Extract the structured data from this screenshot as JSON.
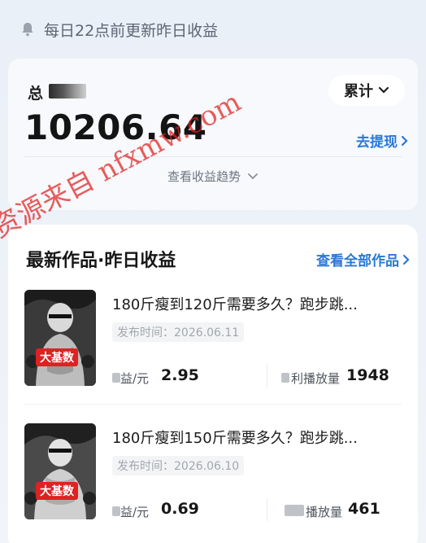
{
  "notice": {
    "text": "每日22点前更新昨日收益",
    "icon": "bell-icon"
  },
  "summary": {
    "total_label": "总",
    "period_label": "累计",
    "amount": "10206.64",
    "withdraw_label": "去提现",
    "trend_label": "查看收益趋势"
  },
  "section": {
    "title": "最新作品·昨日收益",
    "see_all_label": "查看全部作品"
  },
  "items": [
    {
      "title": "180斤瘦到120斤需要多久？跑步跳...",
      "date": "发布时间：2026.06.11",
      "thumb_badge": "大基数",
      "metric1_label": "益/元",
      "metric1_value": "2.95",
      "metric2_label": "利播放量",
      "metric2_value": "1948"
    },
    {
      "title": "180斤瘦到150斤需要多久？跑步跳...",
      "date": "发布时间：2026.06.10",
      "thumb_badge": "大基数",
      "metric1_label": "益/元",
      "metric1_value": "0.69",
      "metric2_label": "播放量",
      "metric2_value": "461"
    }
  ],
  "watermark": "资源来自 nfxmw.com",
  "colors": {
    "accent": "#2a78d6",
    "watermark": "#e11e1e"
  }
}
